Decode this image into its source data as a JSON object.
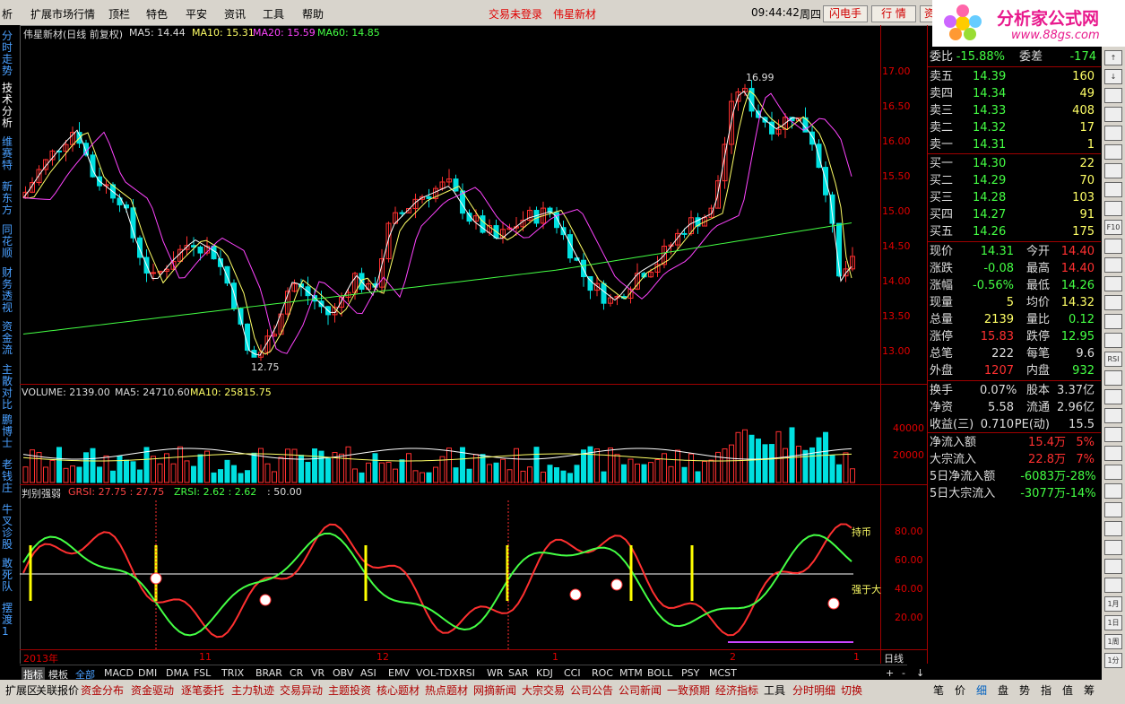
{
  "menu": {
    "items": [
      "析",
      "扩展市场行情",
      "顶栏",
      "特色",
      "平安",
      "资讯",
      "工具",
      "帮助"
    ],
    "status": "交易未登录",
    "stock": "伟星新材",
    "time": "09:44:42",
    "weekday": "周四",
    "btn_flash": "闪电手",
    "btn_quote": "行 情",
    "btn_info": "资"
  },
  "logo": {
    "title": "分析家公式网",
    "url": "www.88gs.com"
  },
  "left_tabs": [
    "分时走势",
    "技术分析",
    "维赛特",
    "新东方",
    "同花顺",
    "财务透视",
    "资金流",
    "主散对比",
    "鹏博士",
    "老钱庄",
    "牛叉诊股",
    "敢死队",
    "摆渡1"
  ],
  "main_chart": {
    "header_name": "伟星新材(日线 前复权)",
    "ma5": "MA5: 14.44",
    "ma10": "MA10: 15.31",
    "ma20": "MA20: 15.59",
    "ma60": "MA60: 14.85",
    "high_label": "16.99",
    "low_label": "12.75",
    "y_ticks": [
      "17.00",
      "16.50",
      "16.00",
      "15.50",
      "15.00",
      "14.50",
      "14.00",
      "13.50",
      "13.00"
    ]
  },
  "volume_chart": {
    "volume": "VOLUME: 2139.00",
    "ma5": "MA5: 24710.60",
    "ma10": "MA10: 25815.75",
    "y_ticks": [
      "40000",
      "20000"
    ]
  },
  "indicator_chart": {
    "name": "判别强弱",
    "grsi": "GRSI: 27.75 : 27.75",
    "zrsi": "ZRSI: 2.62 : 2.62",
    "level": ": 50.00",
    "y_ticks": [
      "80.00",
      "60.00",
      "40.00",
      "20.00"
    ],
    "label_hold": "持币",
    "label_strong": "强于大"
  },
  "time_axis": {
    "year": "2013年",
    "m11": "11",
    "m12": "12",
    "m1": "1",
    "m2": "2",
    "m1b": "1",
    "period": "日线"
  },
  "quote": {
    "webi": [
      "委比",
      "-15.88%",
      "委差",
      "-174"
    ],
    "asks": [
      [
        "卖五",
        "14.39",
        "160"
      ],
      [
        "卖四",
        "14.34",
        "49"
      ],
      [
        "卖三",
        "14.33",
        "408"
      ],
      [
        "卖二",
        "14.32",
        "17"
      ],
      [
        "卖一",
        "14.31",
        "1"
      ]
    ],
    "bids": [
      [
        "买一",
        "14.30",
        "22"
      ],
      [
        "买二",
        "14.29",
        "70"
      ],
      [
        "买三",
        "14.28",
        "103"
      ],
      [
        "买四",
        "14.27",
        "91"
      ],
      [
        "买五",
        "14.26",
        "175"
      ]
    ],
    "stats": [
      [
        "现价",
        "14.31",
        "今开",
        "14.40"
      ],
      [
        "涨跌",
        "-0.08",
        "最高",
        "14.40"
      ],
      [
        "涨幅",
        "-0.56%",
        "最低",
        "14.26"
      ],
      [
        "现量",
        "5",
        "均价",
        "14.32"
      ],
      [
        "总量",
        "2139",
        "量比",
        "0.12"
      ],
      [
        "涨停",
        "15.83",
        "跌停",
        "12.95"
      ],
      [
        "总笔",
        "222",
        "每笔",
        "9.6"
      ],
      [
        "外盘",
        "1207",
        "内盘",
        "932"
      ]
    ],
    "extra": [
      [
        "换手",
        "0.07%",
        "股本",
        "3.37亿"
      ],
      [
        "净资",
        "5.58",
        "流通",
        "2.96亿"
      ],
      [
        "收益(三)",
        "0.710",
        "PE(动)",
        "15.5"
      ]
    ],
    "flows": [
      [
        "净流入额",
        "15.4万",
        "5%"
      ],
      [
        "大宗流入",
        "22.8万",
        "7%"
      ],
      [
        "5日净流入额",
        "-6083万",
        "-28%"
      ],
      [
        "5日大宗流入",
        "-3077万",
        "-14%"
      ]
    ]
  },
  "indicator_bar": {
    "tabs": [
      "指标",
      "模板",
      "全部"
    ],
    "items": [
      "MACD",
      "DMI",
      "DMA",
      "FSL",
      "TRIX",
      "BRAR",
      "CR",
      "VR",
      "OBV",
      "ASI",
      "EMV",
      "VOL-TDX",
      "RSI",
      "WR",
      "SAR",
      "KDJ",
      "CCI",
      "ROC",
      "MTM",
      "BOLL",
      "PSY",
      "MCST"
    ],
    "right": [
      "+",
      "-",
      "↓"
    ]
  },
  "bottom_bar": {
    "items": [
      "扩展区",
      "关联报价",
      "资金分布",
      "资金驱动",
      "逐笔委托",
      "主力轨迹",
      "交易异动",
      "主题投资",
      "核心题材",
      "热点题材",
      "网摘新闻",
      "大宗交易",
      "公司公告",
      "公司新闻",
      "一致预期",
      "经济指标",
      "工具",
      "分时明细",
      "切换"
    ],
    "right": [
      "笔",
      "价",
      "细",
      "盘",
      "势",
      "指",
      "值",
      "筹"
    ]
  },
  "right_tools": [
    "↑",
    "↓",
    "",
    "",
    "",
    "",
    "",
    "",
    "",
    "F10",
    "",
    "",
    "",
    "",
    "",
    "",
    "RSI",
    "",
    "",
    "",
    "",
    "",
    "",
    "",
    "",
    "",
    "",
    "",
    "",
    "1月",
    "1日",
    "1周",
    "1分"
  ]
}
